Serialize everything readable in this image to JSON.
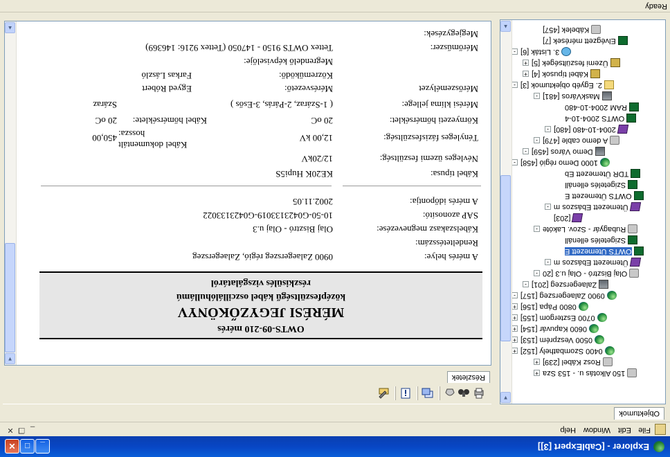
{
  "window": {
    "title": "Explorer - [CablExpert [3]]",
    "minimize_glyph": "_",
    "maximize_glyph": "□",
    "close_glyph": "✕",
    "app_icon": "globe-icon"
  },
  "menu": {
    "items": [
      "File",
      "Edit",
      "Window",
      "Help"
    ],
    "doc_controls": [
      "_",
      "❐",
      "✕"
    ]
  },
  "left_tabs": {
    "objects_label": "Objektumok"
  },
  "right_tabs": {
    "details_label": "Részletek"
  },
  "toolbar": {
    "icons": [
      "print-icon",
      "binoculars-icon",
      "hand-icon",
      "window-icon",
      "info-icon",
      "edit-icon"
    ]
  },
  "tree": {
    "items": [
      {
        "label": "Kábelek [457]",
        "icon": "cable-icon",
        "indent": 3,
        "expander": ""
      },
      {
        "label": "Elvégzett mérések [7]",
        "icon": "chart-icon",
        "indent": 3,
        "expander": ""
      },
      {
        "label": "3. Listák [6]",
        "icon": "search-icon",
        "indent": 1,
        "expander": "-"
      },
      {
        "label": "Üzemi feszültségek [5]",
        "icon": "box-icon",
        "indent": 2,
        "expander": "+"
      },
      {
        "label": "Kábel típusok [4]",
        "icon": "box-icon",
        "indent": 2,
        "expander": "+"
      },
      {
        "label": "2. Egyéb objektumok [3]",
        "icon": "folder-icon",
        "indent": 1,
        "expander": "-"
      },
      {
        "label": "MaskVáros [481]",
        "icon": "city-icon",
        "indent": 3,
        "expander": "-"
      },
      {
        "label": "RAM 2004-10-480",
        "icon": "chart-icon",
        "indent": 5,
        "expander": ""
      },
      {
        "label": "OWTS 2004-10-4",
        "icon": "chart-icon",
        "indent": 5,
        "expander": ""
      },
      {
        "label": "2004-10-480 [480]",
        "icon": "book-icon",
        "indent": 4,
        "expander": "-"
      },
      {
        "label": "A demo cable [479]",
        "icon": "cable-icon",
        "indent": 3,
        "expander": "-"
      },
      {
        "label": "Demo Város [459]",
        "icon": "city-icon",
        "indent": 2,
        "expander": "-"
      },
      {
        "label": "1000 Demo régió [458]",
        "icon": "globe-icon",
        "indent": 1,
        "expander": "-"
      },
      {
        "label": "TDR Ütemezett Eb",
        "icon": "chart-icon",
        "indent": 5,
        "expander": ""
      },
      {
        "label": "Szigetelés ellenáll",
        "icon": "chart-icon",
        "indent": 5,
        "expander": ""
      },
      {
        "label": "OWTS Ütemezett E",
        "icon": "chart-icon",
        "indent": 5,
        "expander": ""
      },
      {
        "label": "Ütemezett Ebászos m",
        "icon": "book-icon",
        "indent": 4,
        "expander": "-"
      },
      {
        "label": "[203]",
        "icon": "book-icon",
        "indent": 4,
        "expander": ""
      },
      {
        "label": "Rubagyár - Szov. Lakóte",
        "icon": "cable-icon",
        "indent": 3,
        "expander": "-"
      },
      {
        "label": "Szigetelés ellenáll",
        "icon": "chart-icon",
        "indent": 5,
        "expander": ""
      },
      {
        "label": "OWTS Ütemezett E",
        "icon": "chart-icon",
        "indent": 5,
        "expander": "",
        "selected": true
      },
      {
        "label": "Ütemezett Ebászos m",
        "icon": "book-icon",
        "indent": 4,
        "expander": "-"
      },
      {
        "label": "Olaj Bisztró - Olaj u.3 [20",
        "icon": "cable-icon",
        "indent": 3,
        "expander": "-"
      },
      {
        "label": "Zalaegerszeg [201]",
        "icon": "city-icon",
        "indent": 2,
        "expander": "-"
      },
      {
        "label": "0900 Zalaegerszeg [157]",
        "icon": "globe-icon",
        "indent": 1,
        "expander": "-"
      },
      {
        "label": "0800 Pápa [156]",
        "icon": "globe-icon",
        "indent": 1,
        "expander": "+"
      },
      {
        "label": "0700 Esztergom [155]",
        "icon": "globe-icon",
        "indent": 1,
        "expander": "+"
      },
      {
        "label": "0600 Kapuvár [154]",
        "icon": "globe-icon",
        "indent": 1,
        "expander": "+"
      },
      {
        "label": "0500 Veszprém [153]",
        "icon": "globe-icon",
        "indent": 1,
        "expander": "+"
      },
      {
        "label": "0400 Szombathely [152]",
        "icon": "globe-icon",
        "indent": 1,
        "expander": "+"
      },
      {
        "label": "Rosz Kábel [239]",
        "icon": "cable-icon",
        "indent": 3,
        "expander": "+"
      },
      {
        "label": "150 Alkotás u. - 153 Sza",
        "icon": "cable-icon",
        "indent": 3,
        "expander": "+"
      }
    ]
  },
  "document": {
    "header": {
      "line1": "OWTS-09-210 mérés",
      "line2": "MÉRÉSI JEGYZŐKÖNYV",
      "line3": "középfeszültségű kábel oszcillálóhullámú",
      "line4": "részkisülés vizsgálatáról"
    },
    "rows": [
      {
        "label": "A mérés helye:",
        "value": "0900 Zalaegerszeg régió, Zalaegerszeg"
      },
      {
        "label": "Rendeltetésszám:",
        "value": ""
      },
      {
        "label": "Kábelszakasz megnevezése:",
        "value": "Olaj Bisztró - Olaj u.3"
      },
      {
        "label": "SAP azonosító:",
        "value": "10-50-G0423133019-G0423133022"
      },
      {
        "label": "A mérés időpontja:",
        "value": "2002.11.05"
      }
    ],
    "cable_type": {
      "label": "Kábel típusa:",
      "value": "KE20K Hupi5S"
    },
    "nominal_voltage": {
      "label": "Névleges üzemi feszültség:",
      "value": "12/20kV"
    },
    "phase_voltage": {
      "label": "Tényleges fázisfeszültség:",
      "value": "12,00 kV"
    },
    "cable_length": {
      "label": "Kábel dokumentált hossza:",
      "value": "450,00"
    },
    "ambient_temp": {
      "label": "Környezeti hőmérséklet:",
      "value": "20 oC"
    },
    "cable_temp": {
      "label": "Kábel hőmérséklete:",
      "value": "20 oC"
    },
    "climate": {
      "label": "Mérési klíma jellege:",
      "value": "( 1-Száraz, 2-Párás, 3-Esős )",
      "extra": "Száraz"
    },
    "measuring_staff": {
      "label": "Mérőszemélyzet",
      "leader_label": "Mérésvezető:",
      "leader": "Egyed Róbert"
    },
    "participant": {
      "label": "Közreműködő:",
      "value": "Farkas László"
    },
    "client_rep": {
      "label": "Megrendelő képviselője:",
      "value": ""
    },
    "instrument": {
      "label": "Mérőműszer:",
      "value": "Tettex OWTS 9150 - 147050 (Tettex 9216: 146369)"
    },
    "notes": {
      "label": "Megjegyzések:",
      "value": ""
    }
  },
  "status": {
    "text": "Ready"
  },
  "colors": {
    "titlebar": "#0a5fd9",
    "selection": "#316ac5",
    "header_bg": "#e6e6e6"
  }
}
